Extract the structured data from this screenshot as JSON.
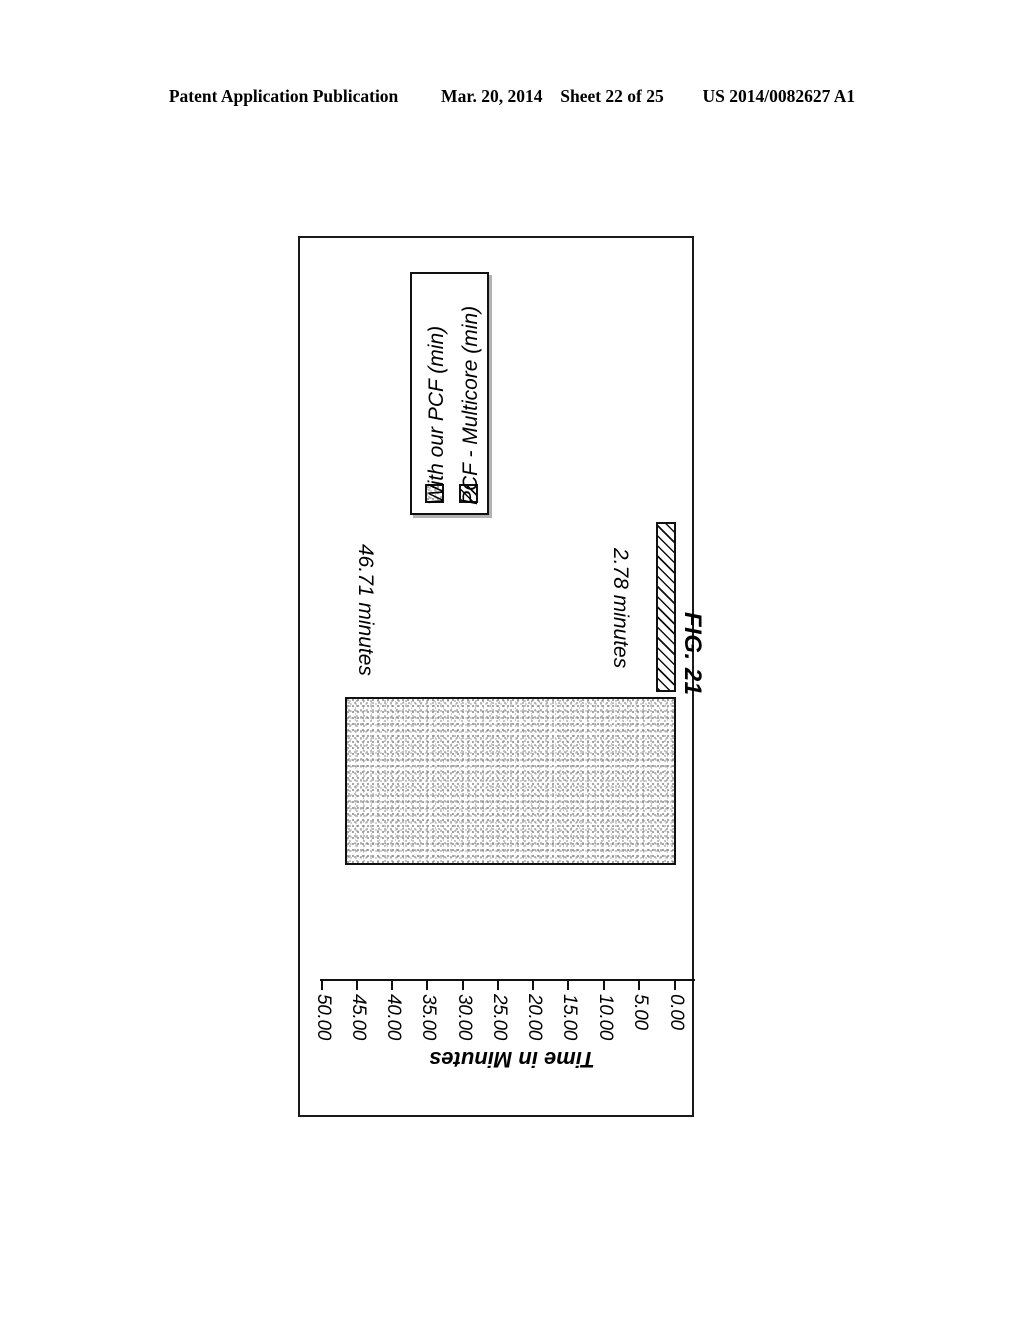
{
  "header": {
    "publication": "Patent Application Publication",
    "date": "Mar. 20, 2014",
    "sheet": "Sheet 22 of 25",
    "patent_number": "US 2014/0082627 A1"
  },
  "figure": {
    "caption": "FIG. 21"
  },
  "chart_data": {
    "type": "bar",
    "orientation": "horizontal",
    "title": "",
    "xlabel": "",
    "ylabel": "Time in Minutes",
    "axis_title": "Time in Minutes",
    "categories": [
      "With our PCF (min)",
      "PCF - Multicore (min)"
    ],
    "values": [
      46.71,
      2.78
    ],
    "value_unit": "minutes",
    "data_labels": [
      "46.71 minutes",
      "2.78 minutes"
    ],
    "tick_labels": [
      "50.00",
      "45.00",
      "40.00",
      "35.00",
      "30.00",
      "25.00",
      "20.00",
      "15.00",
      "10.00",
      "5.00",
      "0.00"
    ],
    "tick_values": [
      50,
      45,
      40,
      35,
      30,
      25,
      20,
      15,
      10,
      5,
      0
    ],
    "axis_range": [
      0,
      50
    ],
    "grid": false,
    "legend_position": "inside-top",
    "series": [
      {
        "name": "With our PCF (min)",
        "values": [
          46.71
        ],
        "pattern": "stipple",
        "color": "#bfbfbf"
      },
      {
        "name": "PCF - Multicore (min)",
        "values": [
          2.78
        ],
        "pattern": "diagonal-hatch",
        "color": "#111111"
      }
    ]
  },
  "legend": {
    "entries": [
      {
        "label": "With our PCF (min)",
        "swatch": "stipple-swatch"
      },
      {
        "label": "PCF - Multicore (min)",
        "swatch": "hatch-swatch"
      }
    ]
  },
  "colors": {
    "ink": "#111111",
    "page_background": "#ffffff",
    "stipple": "#bfbfbf"
  }
}
